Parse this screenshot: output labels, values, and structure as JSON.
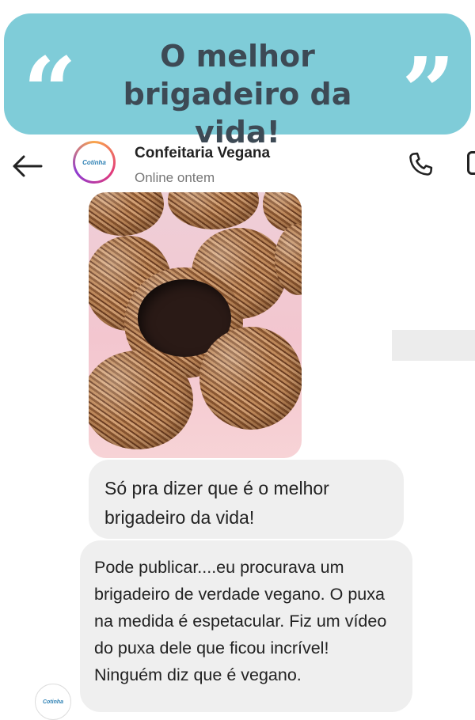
{
  "banner": {
    "title_line1": "O melhor",
    "title_line2": "brigadeiro da vida!",
    "left_quote": "“",
    "right_quote": "”",
    "color": "#7fccd8"
  },
  "header": {
    "back_icon": "back-arrow-icon",
    "avatar_logo": "Cotinha",
    "contact_name": "Confeitaria Vegana",
    "status": "Online ontem",
    "call_icon": "phone-icon",
    "video_icon": "video-camera-icon"
  },
  "messages": [
    {
      "type": "image",
      "subject": "brigadeiros"
    },
    {
      "type": "text",
      "text": "Só pra dizer que é o melhor brigadeiro da vida!"
    },
    {
      "type": "text",
      "text": "Pode publicar....eu procurava um brigadeiro de verdade vegano. O puxa na medida é espetacular. Fiz um vídeo do puxa dele que ficou incrível! Ninguém diz que é vegano."
    }
  ],
  "footer": {
    "avatar_logo": "Cotinha"
  }
}
